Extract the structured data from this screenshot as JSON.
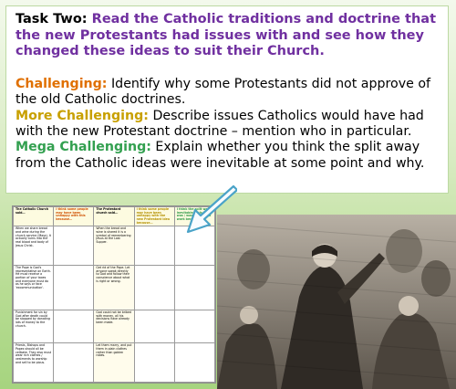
{
  "task": {
    "lead": "Task Two:",
    "text": "Read the Catholic traditions and doctrine that the new Protestants had issues with and see how they changed these ideas to suit their Church."
  },
  "levels": [
    {
      "label": "Challenging:",
      "text": "Identify why some Protestants did not approve of the old Catholic doctrines."
    },
    {
      "label": "More Challenging:",
      "text": "Describe issues Catholics would have had with the new Protestant doctrine – mention who in particular."
    },
    {
      "label": "Mega Challenging:",
      "text": "Explain whether you think the split away from the Catholic ideas were inevitable at some point and why."
    }
  ],
  "worksheet": {
    "headers": [
      "The Catholic Church said…",
      "I think some people may have been unhappy with this because…",
      "The Protestant church said…",
      "I think some people may have been unhappy with the new Protestant idea because…",
      "I think the split was inevitable / this idea was / wasn't likely to work because…"
    ],
    "catholic_rows": [
      "When we share bread and wine during the church service (Mass), it actually turns into the real blood and body of Jesus Christ.",
      "The Pope is God's representative on Earth. He must receive a portion of your taxes and everyone must do as he says or face 'excommunication'.",
      "Punishment for sin by God after death could be stopped by donating lots of money to the church.",
      "Priests, Bishops and Popes should all be celibate. They also must wear rich clothes / vestments to worship and sell to be pious."
    ],
    "protestant_rows": [
      "When the bread and wine is shared it is a symbol of remembering Jesus at the Last Supper.",
      "Get rid of the Pope. Let anyone speak directly to God and follow their conscience about what is right or wrong.",
      "God could not be bribed with money, all his decisions have already been made.",
      "Let them marry, and put them in plain clothes rather than golden robes."
    ]
  }
}
